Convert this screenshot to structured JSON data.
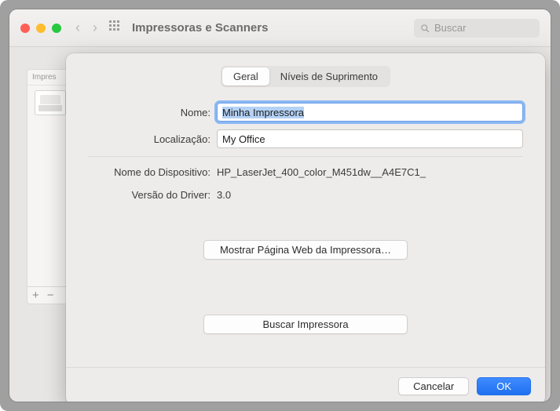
{
  "window": {
    "title": "Impressoras e Scanners",
    "search_placeholder": "Buscar"
  },
  "sidebar": {
    "header": "Impres",
    "add_symbol": "+",
    "remove_symbol": "−"
  },
  "dialog": {
    "tabs": {
      "general": "Geral",
      "supply": "Níveis de Suprimento"
    },
    "labels": {
      "name": "Nome:",
      "location": "Localização:",
      "device_name": "Nome do Dispositivo:",
      "driver_version": "Versão do Driver:"
    },
    "values": {
      "name": "Minha Impressora",
      "location": "My Office",
      "device_name": "HP_LaserJet_400_color_M451dw__A4E7C1_",
      "driver_version": "3.0"
    },
    "buttons": {
      "show_web": "Mostrar Página Web da Impressora…",
      "find_printer": "Buscar Impressora",
      "cancel": "Cancelar",
      "ok": "OK"
    }
  },
  "help_symbol": "?",
  "opts_symbol": "…"
}
